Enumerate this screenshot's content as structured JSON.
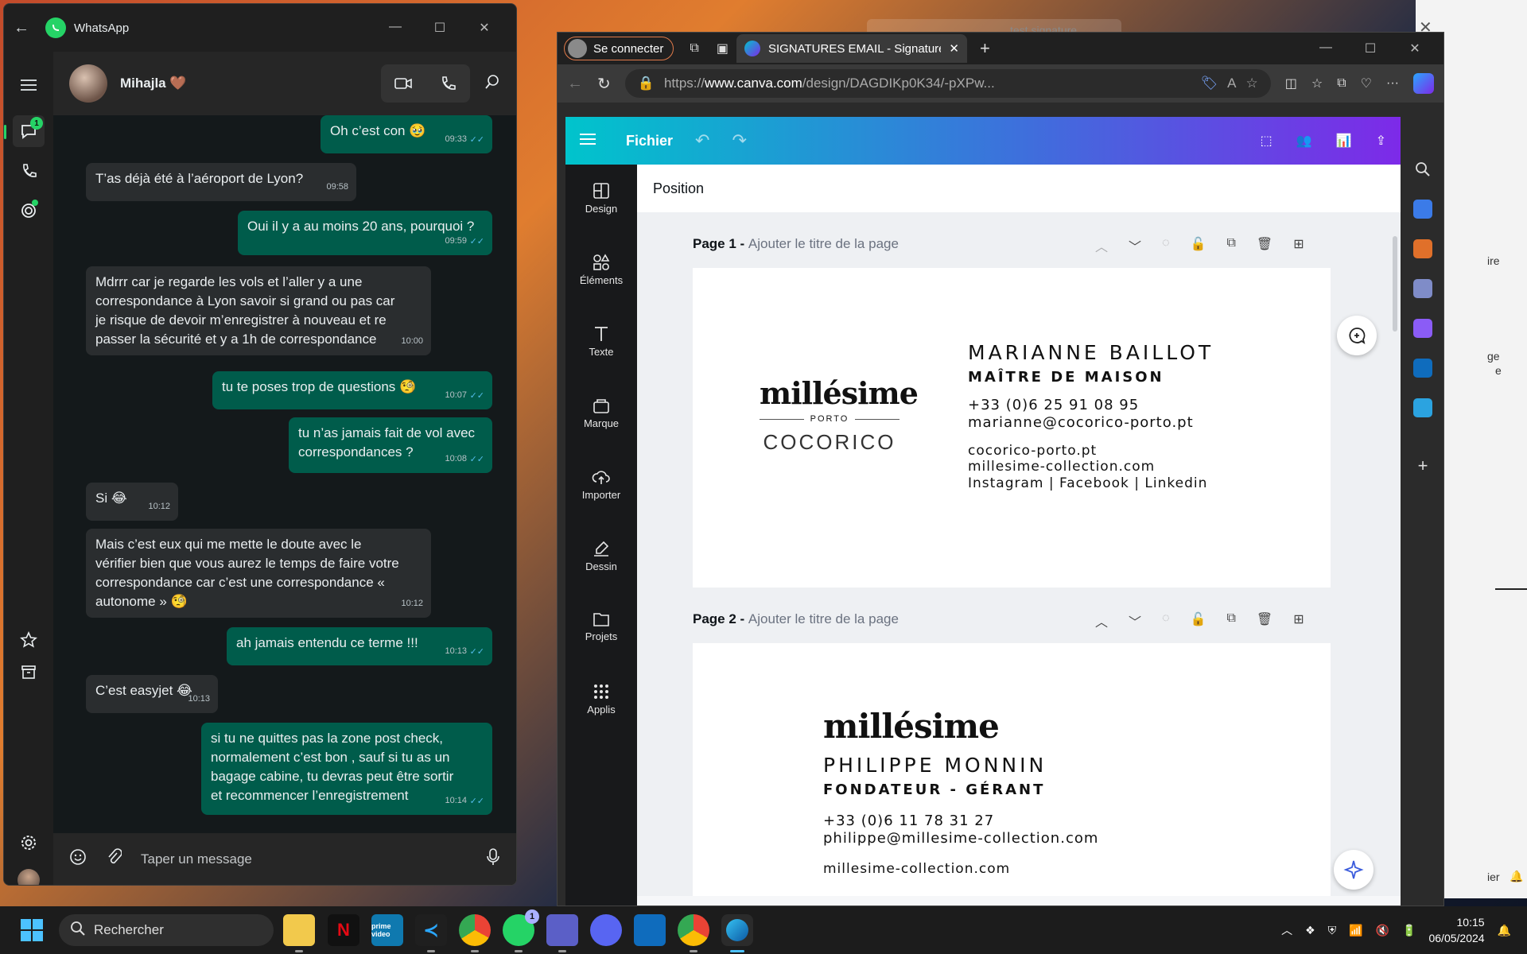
{
  "whatsapp": {
    "app_title": "WhatsApp",
    "chat_name": "Mihajla 🤎",
    "chats_badge": "1",
    "input_placeholder": "Taper un message",
    "messages": [
      {
        "dir": "out",
        "text": "Oh c’est con 🥹",
        "time": "09:33"
      },
      {
        "dir": "in",
        "text": "T’as déjà été à l’aéroport de Lyon?",
        "time": "09:58"
      },
      {
        "dir": "out",
        "text": "Oui il y a au moins 20 ans, pourquoi ?",
        "time": "09:59"
      },
      {
        "dir": "in",
        "text": "Mdrrr car je regarde les vols et l’aller y a une correspondance à Lyon savoir si grand ou pas car je risque de devoir m’enregistrer à nouveau et re passer la sécurité et y a 1h de correspondance",
        "time": "10:00"
      },
      {
        "dir": "out",
        "text": "tu te poses trop de questions 🧐",
        "time": "10:07"
      },
      {
        "dir": "out",
        "text": "tu n’as jamais fait de vol avec correspondances ?",
        "time": "10:08"
      },
      {
        "dir": "in",
        "text": "Si 😂",
        "time": "10:12"
      },
      {
        "dir": "in",
        "text": "Mais c’est eux qui me mette le doute avec le vérifier bien que vous aurez le temps de faire votre correspondance car c’est une correspondance « autonome » 🧐",
        "time": "10:12"
      },
      {
        "dir": "out",
        "text": "ah jamais entendu ce terme !!!",
        "time": "10:13"
      },
      {
        "dir": "in",
        "text": "C’est easyjet 😂",
        "time": "10:13"
      },
      {
        "dir": "out",
        "text": "si tu ne quittes pas la zone post check, normalement c’est bon , sauf si tu as un bagage cabine, tu devras peut être sortir et recommencer  l’enregistrement",
        "time": "10:14"
      }
    ]
  },
  "edge": {
    "login": "Se connecter",
    "tab_title": "SIGNATURES EMAIL - Signature d",
    "url_prefix": "https://",
    "url_domain": "www.canva.com",
    "url_path": "/design/DAGDIKp0K34/-pXPw..."
  },
  "canva": {
    "file_menu": "Fichier",
    "panel_title": "Position",
    "sidebar": [
      {
        "label": "Design",
        "icon": "design-icon"
      },
      {
        "label": "Éléments",
        "icon": "elements-icon"
      },
      {
        "label": "Texte",
        "icon": "text-icon"
      },
      {
        "label": "Marque",
        "icon": "brand-icon"
      },
      {
        "label": "Importer",
        "icon": "upload-icon"
      },
      {
        "label": "Dessin",
        "icon": "draw-icon"
      },
      {
        "label": "Projets",
        "icon": "folder-icon"
      },
      {
        "label": "Applis",
        "icon": "apps-icon"
      }
    ],
    "page1": {
      "label": "Page 1 - ",
      "title_placeholder": "Ajouter le titre de la page",
      "logo_word": "millésime",
      "logo_sub": "PORTO",
      "logo_brand": "COCORICO",
      "name": "MARIANNE BAILLOT",
      "role": "MAÎTRE DE MAISON",
      "phone": "+33 (0)6 25 91 08 95",
      "email": "marianne@cocorico-porto.pt",
      "site1": "cocorico-porto.pt",
      "site2": "millesime-collection.com",
      "social": "Instagram | Facebook | Linkedin"
    },
    "page2": {
      "label": "Page 2 - ",
      "title_placeholder": "Ajouter le titre de la page",
      "logo_word": "millésime",
      "name": "PHILIPPE MONNIN",
      "role": "FONDATEUR - GÉRANT",
      "phone": "+33 (0)6 11 78 31 27",
      "email": "philippe@millesime-collection.com",
      "site1": "millesime-collection.com"
    }
  },
  "background": {
    "search_text": "test signature",
    "side_text_1": "ire",
    "side_text_2": "ge",
    "side_text_3": "e",
    "side_text_4": "ier"
  },
  "taskbar": {
    "search_placeholder": "Rechercher",
    "whatsapp_badge": "1",
    "time": "10:15",
    "date": "06/05/2024",
    "netflix": "N",
    "prime": "prime video"
  }
}
